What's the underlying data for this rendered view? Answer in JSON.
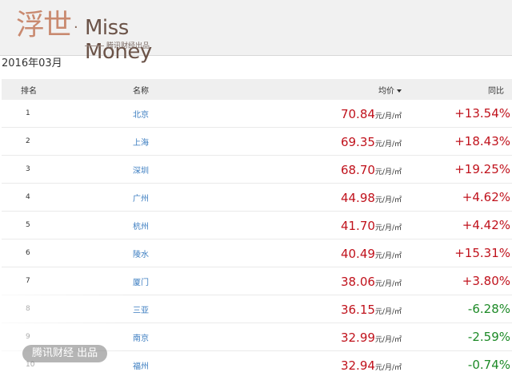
{
  "header": {
    "logo_cn": "浮世",
    "logo_dot": "·",
    "logo_en": "Miss Money",
    "logo_sub": "腾讯财经出品"
  },
  "date": "2016年03月",
  "table": {
    "headers": {
      "rank": "排名",
      "name": "名称",
      "price": "均价",
      "change": "同比"
    },
    "unit": "元/月/㎡",
    "rows": [
      {
        "rank": "1",
        "name": "北京",
        "price": "70.84",
        "change": "+13.54%"
      },
      {
        "rank": "2",
        "name": "上海",
        "price": "69.35",
        "change": "+18.43%"
      },
      {
        "rank": "3",
        "name": "深圳",
        "price": "68.70",
        "change": "+19.25%"
      },
      {
        "rank": "4",
        "name": "广州",
        "price": "44.98",
        "change": "+4.62%"
      },
      {
        "rank": "5",
        "name": "杭州",
        "price": "41.70",
        "change": "+4.42%"
      },
      {
        "rank": "6",
        "name": "陵水",
        "price": "40.49",
        "change": "+15.31%"
      },
      {
        "rank": "7",
        "name": "厦门",
        "price": "38.06",
        "change": "+3.80%"
      },
      {
        "rank": "8",
        "name": "三亚",
        "price": "36.15",
        "change": "-6.28%"
      },
      {
        "rank": "9",
        "name": "南京",
        "price": "32.99",
        "change": "-2.59%"
      },
      {
        "rank": "10",
        "name": "福州",
        "price": "32.94",
        "change": "-0.74%"
      }
    ]
  },
  "watermark": "腾讯财经 出品",
  "colors": {
    "up": "#c0121c",
    "down": "#1d8a27",
    "link": "#3a7cc0"
  }
}
